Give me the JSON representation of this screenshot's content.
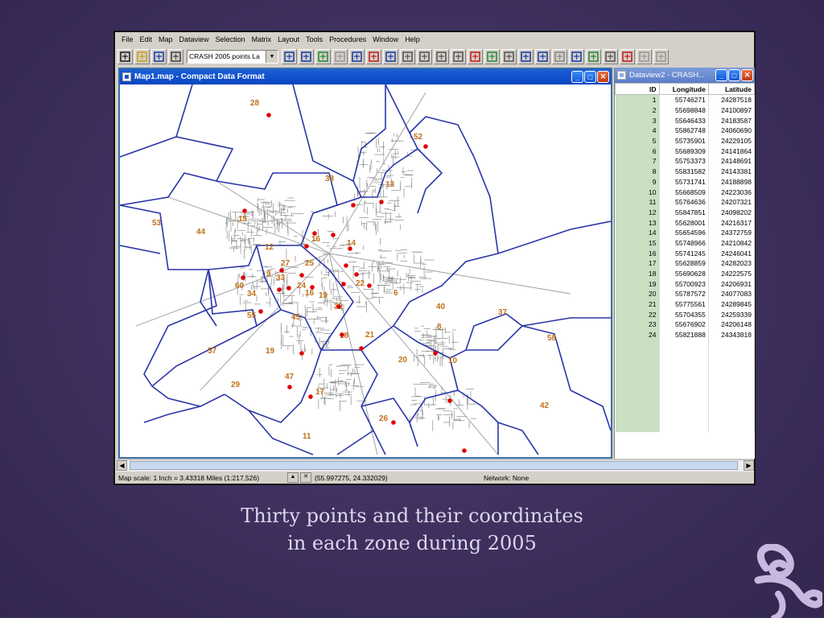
{
  "menu": [
    "File",
    "Edit",
    "Map",
    "Dataview",
    "Selection",
    "Matrix",
    "Layout",
    "Tools",
    "Procedures",
    "Window",
    "Help"
  ],
  "toolbar": {
    "layer_select": "CRASH 2005 points La",
    "icons": [
      "new-file-icon",
      "open-folder-icon",
      "save-icon",
      "print-icon",
      "layer-select",
      "table-icon",
      "chart-icon",
      "map-tool-icon",
      "select-tool-icon",
      "network-icon",
      "shortest-path-icon",
      "route-icon",
      "matrix-icon",
      "layout-icon",
      "list-icon",
      "filter-icon",
      "highlight-icon",
      "theme-icon",
      "label-icon",
      "export-icon",
      "pin-icon",
      "grid-icon",
      "layer-icon",
      "globe-icon",
      "pointer-icon",
      "edit-icon",
      "chart-line-icon",
      "copy-icon"
    ]
  },
  "map_window": {
    "title": "Map1.map - Compact Data Format",
    "zone_labels": [
      "28",
      "52",
      "33",
      "13",
      "53",
      "44",
      "15",
      "12",
      "16",
      "14",
      "25",
      "27",
      "9",
      "60",
      "34",
      "33",
      "16",
      "32",
      "24",
      "19",
      "22",
      "6",
      "55",
      "45",
      "40",
      "37",
      "8",
      "18",
      "21",
      "58",
      "57",
      "19",
      "20",
      "10",
      "47",
      "29",
      "17",
      "42",
      "26",
      "11"
    ],
    "crash_points_count": 30
  },
  "data_window": {
    "title": "Dataview2 - CRASH...",
    "columns": [
      "ID",
      "Longitude",
      "Latitude"
    ],
    "rows": [
      [
        "1",
        "55746271",
        "24287518"
      ],
      [
        "2",
        "55698848",
        "24100897"
      ],
      [
        "3",
        "55646433",
        "24183587"
      ],
      [
        "4",
        "55862748",
        "24060690"
      ],
      [
        "5",
        "55735901",
        "24229105"
      ],
      [
        "6",
        "55689309",
        "24141864"
      ],
      [
        "7",
        "55753373",
        "24148691"
      ],
      [
        "8",
        "55831582",
        "24143381"
      ],
      [
        "9",
        "55731741",
        "24188898"
      ],
      [
        "10",
        "55668509",
        "24223036"
      ],
      [
        "11",
        "55764636",
        "24207321"
      ],
      [
        "12",
        "55847851",
        "24098202"
      ],
      [
        "13",
        "55628001",
        "24216317"
      ],
      [
        "14",
        "55654596",
        "24372759"
      ],
      [
        "15",
        "55748966",
        "24210842"
      ],
      [
        "16",
        "55741245",
        "24246041"
      ],
      [
        "17",
        "55628859",
        "24282023"
      ],
      [
        "18",
        "55690628",
        "24222575"
      ],
      [
        "19",
        "55700923",
        "24206931"
      ],
      [
        "20",
        "55787572",
        "24077083"
      ],
      [
        "21",
        "55775561",
        "24289845"
      ],
      [
        "22",
        "55704355",
        "24259339"
      ],
      [
        "23",
        "55676902",
        "24206148"
      ],
      [
        "24",
        "55821888",
        "24343818"
      ]
    ]
  },
  "status": {
    "scale": "Map scale: 1 Inch = 3.43318 Miles (1:217,526)",
    "coords": "(55.997275, 24.332029)",
    "network": "Network: None"
  },
  "caption": {
    "line1": "Thirty points and their coordinates",
    "line2": "in each zone during 2005"
  },
  "colors": {
    "background": "#3d2e5c",
    "zone_border": "#2a35a8",
    "street": "#8a8a8a",
    "crash_point": "#e00000",
    "zone_label": "#c0701a",
    "titlebar": "#0b46c2"
  }
}
